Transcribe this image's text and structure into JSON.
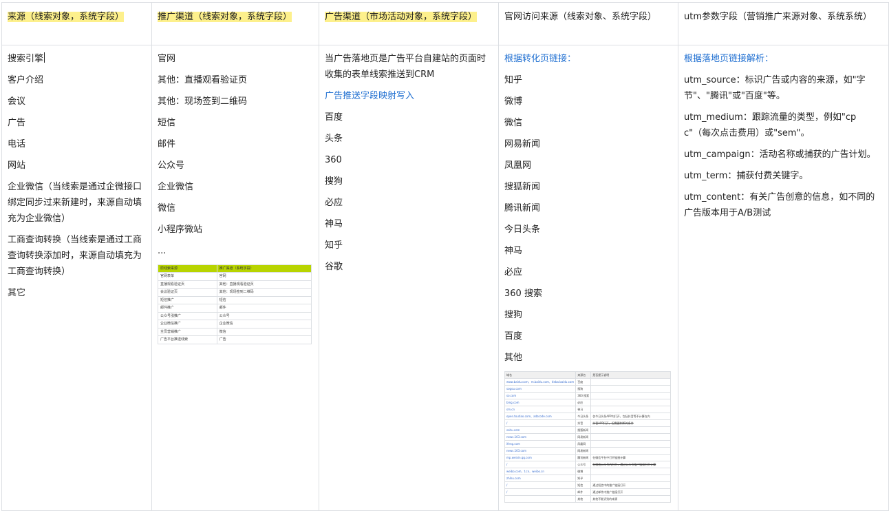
{
  "headers": [
    "来源（线索对象，系统字段）",
    "推广渠道（线索对象，系统字段）",
    "广告渠道（市场活动对象，系统字段）",
    "官网访问来源（线索对象、系统字段）",
    "utm参数字段（营销推广来源对象、系统系统）"
  ],
  "col1": {
    "items": [
      "搜索引擎",
      "客户介绍",
      "会议",
      "广告",
      "电话",
      "网站",
      "企业微信（当线索是通过企微接口绑定同步过来新建时，来源自动填充为企业微信）",
      "工商查询转换（当线索是通过工商查询转换添加时，来源自动填充为工商查询转换）",
      "其它"
    ]
  },
  "col2": {
    "items": [
      "官网",
      "其他：直播观看验证页",
      "其他：现场签到二维码",
      "短信",
      "邮件",
      "公众号",
      "企业微信",
      "微信",
      "小程序微站",
      "..."
    ],
    "mini_table": {
      "header": [
        "原线索来源",
        "推广渠道（系统字段）"
      ],
      "rows": [
        [
          "官网表单",
          "官网"
        ],
        [
          "直播观看验证页",
          "其他：直播观看验证页"
        ],
        [
          "会议验证页",
          "其他：现场签到二维码"
        ],
        [
          "短信推广",
          "短信"
        ],
        [
          "邮件推广",
          "邮件"
        ],
        [
          "公众号涨推广",
          "公众号"
        ],
        [
          "企业微信推广",
          "企业微信"
        ],
        [
          "全员营销推广",
          "微信"
        ],
        [
          "广告平台推送线索",
          "广告"
        ]
      ]
    }
  },
  "col3": {
    "intro": "当广告落地页是广告平台自建站的页面时收集的表单线索推送到CRM",
    "link": "广告推送字段映射写入",
    "items": [
      "百度",
      "头条",
      "360",
      "搜狗",
      "必应",
      "神马",
      "知乎",
      "谷歌"
    ]
  },
  "col4": {
    "link": "根据转化页链接：",
    "items": [
      "知乎",
      "微博",
      "微信",
      "网易新闻",
      "凤凰网",
      "搜狐新闻",
      "腾讯新闻",
      "今日头条",
      "神马",
      "必应",
      "360 搜索",
      "搜狗",
      "百度",
      "其他"
    ],
    "mini_table": {
      "header": [
        "域名",
        "来源名",
        "是否提示说明"
      ],
      "rows": [
        [
          "www.baidu.com、m.baidu.com、tieba.baidu.com",
          "百度",
          ""
        ],
        [
          "sogou.com",
          "搜狗",
          ""
        ],
        [
          "so.com",
          "360 搜索",
          ""
        ],
        [
          "bing.com",
          "必应",
          ""
        ],
        [
          "sm.cn",
          "神马",
          ""
        ],
        [
          "open.toutiao.com、adzcode.com",
          "今日头条",
          "仅今日头条APP内打开，包括抖音等不计算在内"
        ],
        [
          "/",
          "抖音",
          "抖音APP打开，但需要判断的条件"
        ],
        [
          "sohu.com",
          "搜狐新闻",
          ""
        ],
        [
          "news.163.com",
          "网易新闻",
          ""
        ],
        [
          "ifeng.com",
          "凤凰网",
          ""
        ],
        [
          "news.163.com",
          "网易新闻",
          ""
        ],
        [
          "mp.weixin.qq.com",
          "腾讯新闻",
          "在微信平台中打开链接计算"
        ],
        [
          "/",
          "公众号",
          "在微信公众号内打开，通过公众号推广链接打开计算"
        ],
        [
          "weibo.com、t.cn、weibo.cn",
          "微博",
          ""
        ],
        [
          "zhihu.com",
          "知乎",
          ""
        ],
        [
          "/",
          "短信",
          "通过短信中的推广链接打开"
        ],
        [
          "/",
          "邮件",
          "通过邮件内推广链接打开"
        ],
        [
          "",
          "其他",
          "其他不能识别的来源"
        ]
      ]
    }
  },
  "col5": {
    "link": "根据落地页链接解析：",
    "items": [
      "utm_source：标识广告或内容的来源，如\"字节\"、\"腾讯\"或\"百度\"等。",
      "utm_medium：跟踪流量的类型，例如\"cpc\"（每次点击费用）或\"sem\"。",
      "utm_campaign：活动名称或捕获的广告计划。",
      "utm_term：捕获付费关键字。",
      "utm_content：有关广告创意的信息，如不同的广告版本用于A/B测试"
    ]
  },
  "colors": {
    "highlight": "#fdf08c",
    "link": "#1f6fd1",
    "mini_header": "#b8d400"
  }
}
